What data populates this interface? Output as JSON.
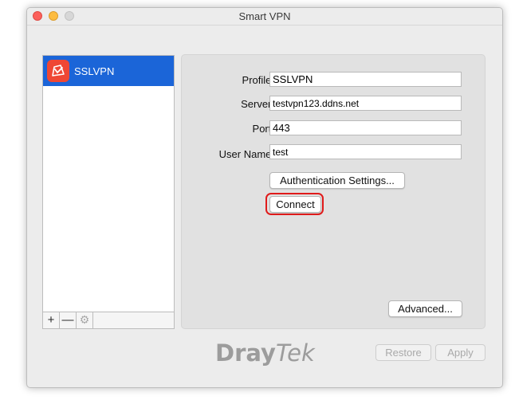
{
  "window": {
    "title": "Smart VPN"
  },
  "sidebar": {
    "items": [
      {
        "label": "SSLVPN",
        "icon": "draytek-app-icon",
        "selected": true
      }
    ],
    "toolbar": {
      "add_label": "+",
      "remove_label": "—",
      "settings_icon": "gear-icon"
    }
  },
  "form": {
    "profile": {
      "label": "Profile:",
      "value": "SSLVPN"
    },
    "server": {
      "label": "Server:",
      "value": "testvpn123.ddns.net"
    },
    "port": {
      "label": "Port:",
      "value": "443"
    },
    "username": {
      "label": "User Name:",
      "value": "test"
    }
  },
  "buttons": {
    "auth_settings": "Authentication Settings...",
    "connect": "Connect",
    "advanced": "Advanced...",
    "restore": "Restore",
    "apply": "Apply"
  },
  "brand": {
    "logo_part1": "Dray",
    "logo_part2": "Tek"
  },
  "colors": {
    "selection": "#1b65d8",
    "app_icon": "#ef4734",
    "highlight": "#e01b1b"
  }
}
